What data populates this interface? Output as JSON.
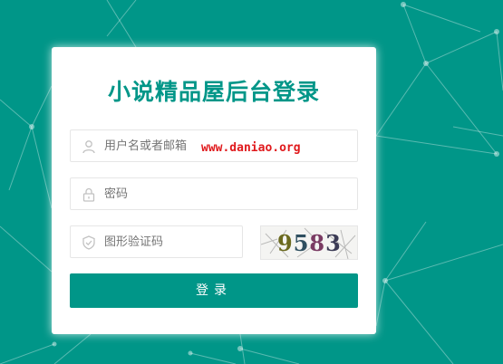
{
  "page": {
    "title": "小说精品屋后台登录"
  },
  "form": {
    "username_placeholder": "用户名或者邮箱",
    "password_placeholder": "密码",
    "captcha_placeholder": "图形验证码",
    "captcha_digits": [
      "9",
      "5",
      "8",
      "3"
    ],
    "submit_label": "登录"
  },
  "watermark": "www.daniao.org",
  "colors": {
    "accent": "#009688",
    "watermark": "#e0191c",
    "background": "#009688"
  },
  "icons": {
    "username": "user-icon",
    "password": "lock-icon",
    "captcha": "shield-icon"
  }
}
